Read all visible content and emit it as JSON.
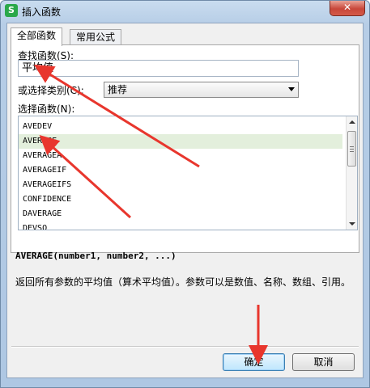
{
  "window": {
    "title": "插入函数",
    "app_icon_letter": "S",
    "close_label": "✕"
  },
  "tabs": [
    {
      "label": "全部函数",
      "active": true
    },
    {
      "label": "常用公式",
      "active": false
    }
  ],
  "search": {
    "label": "查找函数(S):",
    "value": "平均值"
  },
  "category": {
    "label": "或选择类别(C):",
    "selected": "推荐"
  },
  "function_list": {
    "label": "选择函数(N):",
    "items": [
      "AVEDEV",
      "AVERAGE",
      "AVERAGEA",
      "AVERAGEIF",
      "AVERAGEIFS",
      "CONFIDENCE",
      "DAVERAGE",
      "DEVSQ"
    ],
    "selected_index": 1
  },
  "syntax": "AVERAGE(number1, number2, ...)",
  "description": "返回所有参数的平均值（算术平均值）。参数可以是数值、名称、数组、引用。",
  "buttons": {
    "ok": "确定",
    "cancel": "取消"
  },
  "colors": {
    "annotation_arrow": "#e8362d",
    "selected_row": "#e3efdc"
  }
}
